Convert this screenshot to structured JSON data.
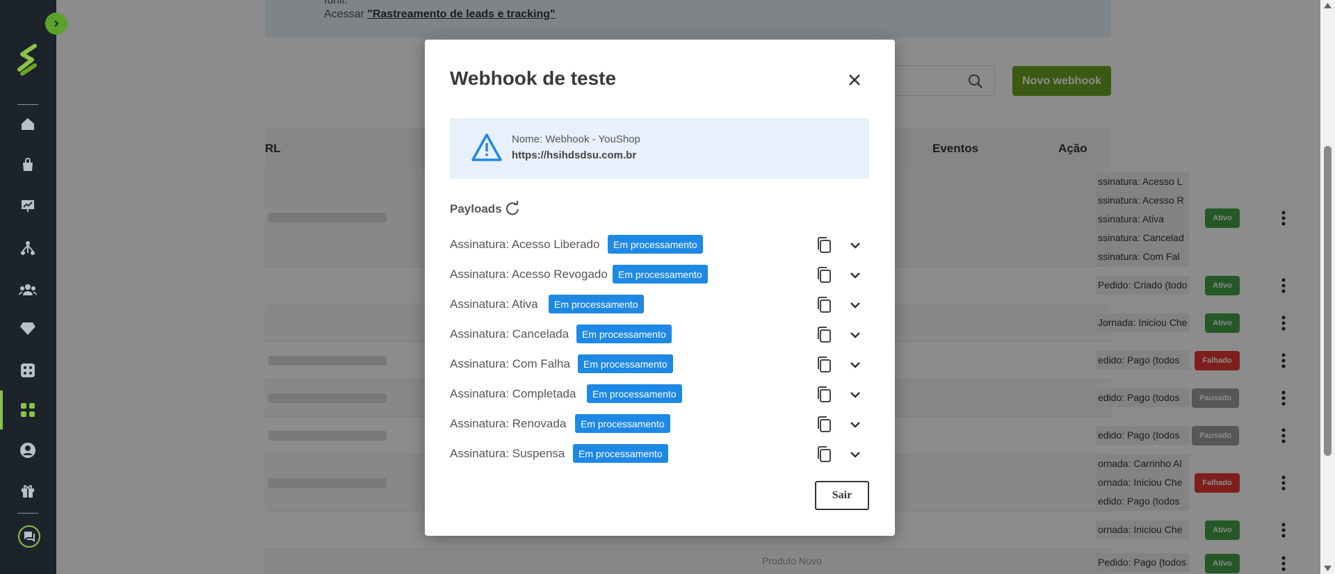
{
  "notice": {
    "line1": "funil.",
    "prefix": "Acessar ",
    "link": "\"Rastreamento de leads e tracking\""
  },
  "toolbar": {
    "new_webhook_label": "Novo webhook",
    "search_icon": "search-icon"
  },
  "table": {
    "headers": [
      "RL",
      "Eventos",
      "Ação"
    ],
    "rows": [
      {
        "events": [
          "ssinatura: Acesso L",
          "ssinatura: Acesso R",
          "ssinatura: Ativa",
          "ssinatura: Cancelad",
          "ssinatura: Com Fal"
        ],
        "status": "Ativo"
      },
      {
        "events": [
          "Pedido: Criado (todo"
        ],
        "status": "Ativo"
      },
      {
        "events": [
          "Jornada: Iniciou Che"
        ],
        "status": "Ativo"
      },
      {
        "events": [
          "edido: Pago (todos"
        ],
        "status": "Falhado"
      },
      {
        "events": [
          "edido: Pago (todos"
        ],
        "status": "Pausado"
      },
      {
        "events": [
          "edido: Pago (todos"
        ],
        "status": "Pausado"
      },
      {
        "events": [
          "ornada: Carrinho Al",
          "ornada: Iniciou Che",
          "edido: Pago (todos"
        ],
        "status": "Falhado"
      },
      {
        "events": [
          "ornada: Iniciou Che"
        ],
        "status": "Ativo"
      },
      {
        "events": [
          "Pedido: Pago (todos"
        ],
        "status": "Ativo",
        "extra": "Produto Novo"
      }
    ]
  },
  "modal": {
    "title": "Webhook de teste",
    "info_name": "Nome: Webhook - YouShop",
    "info_url": "https://hsihdsdsu.com.br",
    "payloads_label": "Payloads",
    "payloads": [
      {
        "name": "Assinatura: Acesso Liberado",
        "status": "Em processamento"
      },
      {
        "name": "Assinatura: Acesso Revogado",
        "status": "Em processamento"
      },
      {
        "name": "Assinatura: Ativa",
        "status": "Em processamento"
      },
      {
        "name": "Assinatura: Cancelada",
        "status": "Em processamento"
      },
      {
        "name": "Assinatura: Com Falha",
        "status": "Em processamento"
      },
      {
        "name": "Assinatura: Completada",
        "status": "Em processamento"
      },
      {
        "name": "Assinatura: Renovada",
        "status": "Em processamento"
      },
      {
        "name": "Assinatura: Suspensa",
        "status": "Em processamento"
      }
    ],
    "exit_label": "Sair"
  },
  "colors": {
    "brand_green": "#6aa523",
    "badge_blue": "#1e88e5",
    "sidebar": "#1c232b",
    "ativo": "#43a047",
    "falhado": "#e53935",
    "pausado": "#9e9e9e"
  }
}
